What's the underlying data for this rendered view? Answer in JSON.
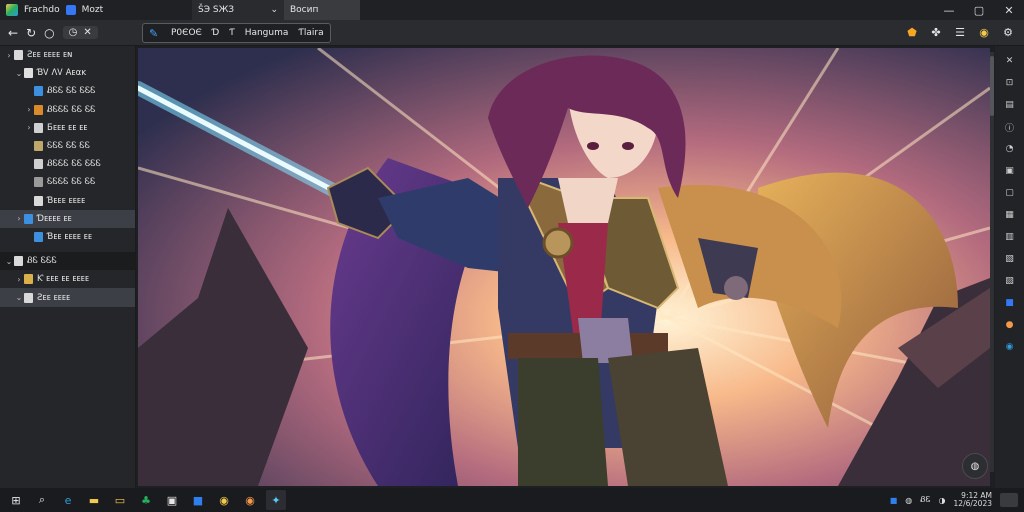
{
  "titlebar": {
    "app_name": "Frachdo",
    "app_secondary": "Mozt",
    "tab1_label": "ŠЭ ЅЖЗ",
    "tab2_label": "Восип",
    "win_minimize": "—",
    "win_restore": "▢",
    "win_close": "✕"
  },
  "toolbar": {
    "mini_label": "✕",
    "path_segments": [
      "P0ЄОЄ",
      "Ɗ",
      "Ƭ",
      "Hanguma",
      "Ƭlaira"
    ]
  },
  "sidebar": {
    "items": [
      {
        "label": "Ƨᴇᴇ ᴇᴇᴇᴇ ᴇɴ",
        "chevron": "›",
        "indent": 0,
        "color": "#d9d9d9"
      },
      {
        "label": "ƁᏙ ΛᏙ Αᴇαᴋ",
        "chevron": "⌄",
        "indent": 1,
        "color": "#e0e0e0"
      },
      {
        "label": "ᏰᏋᏋ ᏋᏋ ᏋᏋᏋ",
        "chevron": "",
        "indent": 2,
        "color": "#3d8fe0"
      },
      {
        "label": "ᏰᏋᏋᏋ ᏋᏋ ᏋᏋ",
        "chevron": "›",
        "indent": 2,
        "color": "#d98b2b"
      },
      {
        "label": "Ƃᴇᴇᴇ ᴇᴇ ᴇᴇ",
        "chevron": "›",
        "indent": 2,
        "color": "#d0d0d0"
      },
      {
        "label": "ᏋᏋᏋ ᏋᏋ ᏋᏋ",
        "chevron": "",
        "indent": 2,
        "color": "#c0a86a"
      },
      {
        "label": "ᏰᏋᏋᏋ ᏋᏋ ᏋᏋᏋ",
        "chevron": "",
        "indent": 2,
        "color": "#d0d0d0"
      },
      {
        "label": "ᏋᏋᏋᏋ ᏋᏋ ᏋᏋ",
        "chevron": "",
        "indent": 2,
        "color": "#9a9a9a"
      },
      {
        "label": "Ɓᴇᴇᴇ ᴇᴇᴇᴇ",
        "chevron": "",
        "indent": 2,
        "color": "#d9d9d9"
      },
      {
        "label": "Ɗᴇᴇᴇᴇ ᴇᴇ",
        "chevron": "›",
        "indent": 1,
        "color": "#3d8fe0",
        "selected": true
      },
      {
        "label": "Ɓᴇᴇ ᴇᴇᴇᴇ ᴇᴇ",
        "chevron": "",
        "indent": 2,
        "color": "#3d8fe0"
      },
      {
        "label": "ᏰᏋ ᏋᏋᏋ",
        "chevron": "⌄",
        "indent": 0,
        "color": "#d9d9d9",
        "dark": true
      },
      {
        "label": "Ƙ ᴇᴇᴇ ᴇᴇ ᴇᴇᴇᴇ",
        "chevron": "›",
        "indent": 1,
        "color": "#d9b04a"
      },
      {
        "label": "Ƨᴇᴇ ᴇᴇᴇᴇ",
        "chevron": "⌄",
        "indent": 1,
        "color": "#d9d9d9",
        "selected": true
      }
    ]
  },
  "colors": {
    "accent": "#3478f6",
    "sky_top": "#3b3f5e",
    "glow": "#ffd9a0",
    "hair": "#6b2a58",
    "saber": "#7fe3ff"
  },
  "taskbar": {
    "clock_time": "9:12 AM",
    "clock_date": "12/6/2023",
    "tray_label": "ᏰᏋ"
  }
}
